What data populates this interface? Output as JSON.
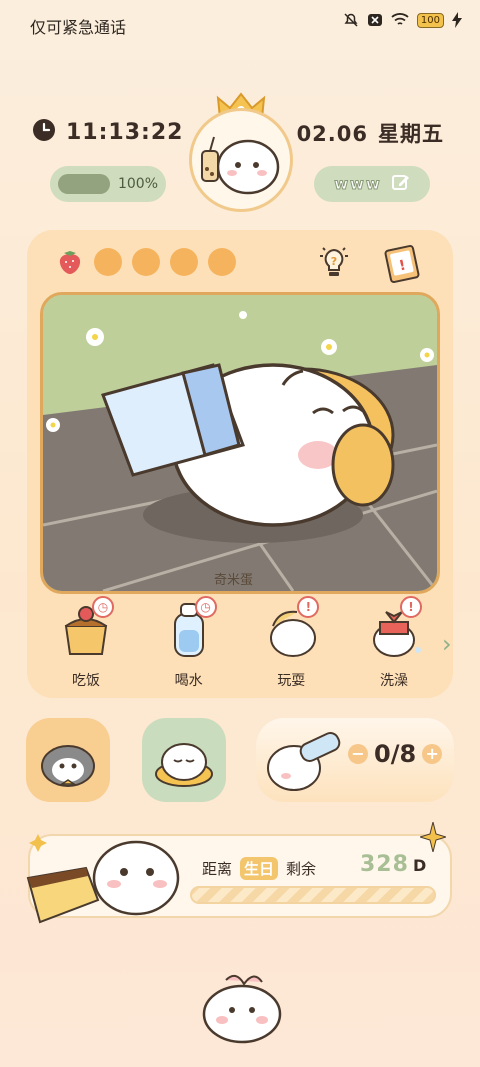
{
  "status_bar": {
    "carrier_text": "仅可紧急通话",
    "battery": "100"
  },
  "header": {
    "time": "11:13:22",
    "date": "02.06",
    "weekday": "星期五",
    "battery_percent_label": "100%",
    "battery_level": 1.0,
    "pet_name": "www"
  },
  "fruits": [
    "strawberry",
    "orange",
    "orange",
    "orange",
    "orange"
  ],
  "scene": {
    "caption": "奇米蛋"
  },
  "actions": [
    {
      "label": "吃饭",
      "badge_icon": "clock-icon"
    },
    {
      "label": "喝水",
      "badge_icon": "clock-icon"
    },
    {
      "label": "玩耍",
      "badge_icon": "alert-icon"
    },
    {
      "label": "洗澡",
      "badge_icon": "alert-icon"
    }
  ],
  "water": {
    "count": "0/8",
    "minus": "−",
    "plus": "+"
  },
  "birthday": {
    "prefix": "距离",
    "highlight": "生日",
    "suffix": "剩余",
    "days": "328",
    "unit": "D"
  },
  "colors": {
    "background": "#fbeedd",
    "card": "#fde0b8",
    "pill_green": "#cfdcbe",
    "accent_orange": "#f6b35e"
  }
}
